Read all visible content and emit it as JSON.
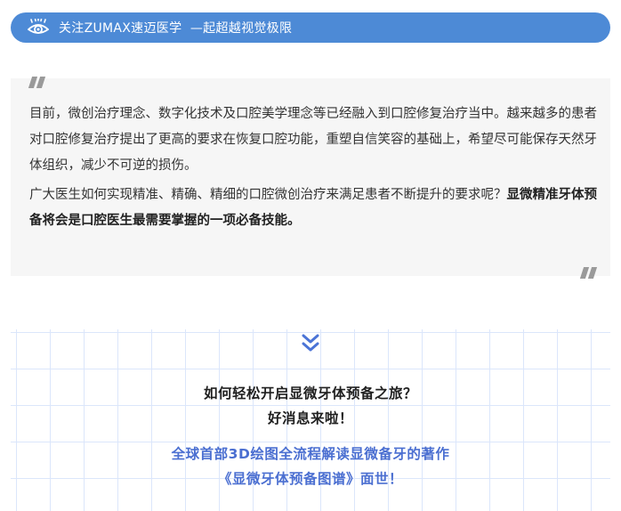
{
  "banner": {
    "text": "关注ZUMAX速迈医学  —起超越视觉极限",
    "icon": "eye-icon",
    "color": "#4d8ad6"
  },
  "quote": {
    "open_icon": "open-quote-icon",
    "close_icon": "close-quote-icon",
    "paragraph1": "目前，微创治疗理念、数字化技术及口腔美学理念等已经融入到口腔修复治疗当中。越来越多的患者对口腔修复治疗提出了更高的要求在恢复口腔功能，重塑自信笑容的基础上，希望尽可能保存天然牙体组织，减少不可逆的损伤。",
    "paragraph2_normal": "广大医生如何实现精准、精确、精细的口腔微创治疗来满足患者不断提升的要求呢？",
    "paragraph2_bold": "显微精准牙体预备将会是口腔医生最需要掌握的一项必备技能。"
  },
  "promo": {
    "chevron_icon": "double-chevron-down-icon",
    "line1": "如何轻松开启显微牙体预备之旅？",
    "line2": "好消息来啦！",
    "line3": "全球首部3D绘图全流程解读显微备牙的著作",
    "line4": "《显微牙体预备图谱》面世！",
    "accent_color": "#4b6fd1"
  }
}
